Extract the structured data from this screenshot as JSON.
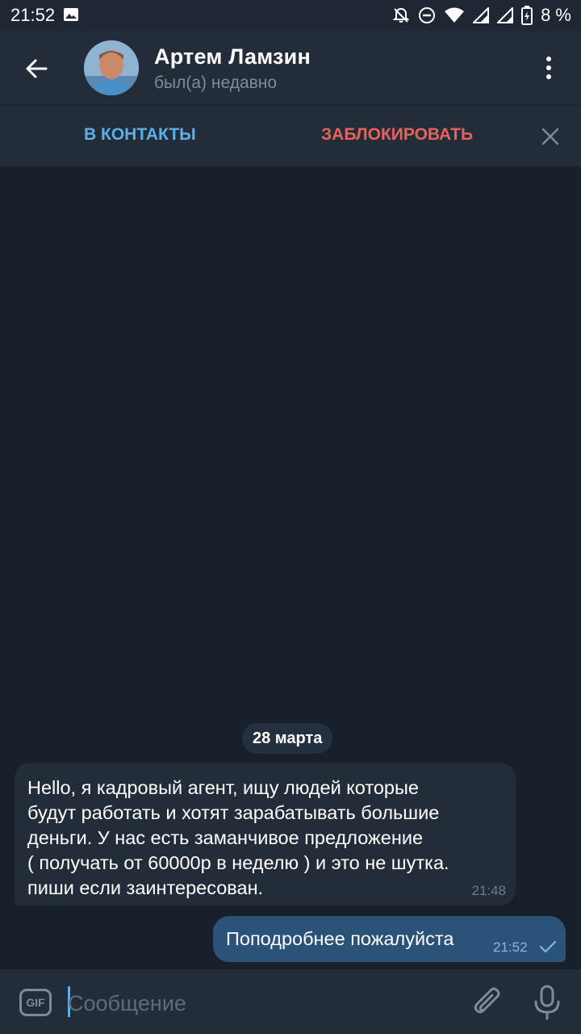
{
  "status_bar": {
    "time": "21:52",
    "battery": "8 %",
    "icons": [
      "image-icon",
      "bell-off-icon",
      "do-not-disturb-icon",
      "wifi-icon",
      "signal-icon",
      "signal-icon",
      "battery-icon"
    ]
  },
  "header": {
    "contact_name": "Артем Ламзин",
    "contact_status": "был(а) недавно",
    "back_icon": "arrow-left-icon",
    "menu_icon": "more-vertical-icon"
  },
  "action_bar": {
    "add_contact_label": "В КОНТАКТЫ",
    "block_label": "ЗАБЛОКИРОВАТЬ",
    "close_icon": "close-icon",
    "add_color": "#5eaee8",
    "block_color": "#e5635b"
  },
  "chat": {
    "date_separator": "28 марта",
    "messages": [
      {
        "direction": "incoming",
        "text": "Hello, я кадровый агент, ищу людей которые\nбудут работать и хотят зарабатывать большие\nденьги.  У нас есть заманчивое предложение\n( получать от 60000р в неделю ) и это не шутка.\nпиши если заинтересован.",
        "time": "21:48"
      },
      {
        "direction": "outgoing",
        "text": "Поподробнее пожалуйста",
        "time": "21:52",
        "status": "sent"
      }
    ]
  },
  "input_bar": {
    "gif_label": "GIF",
    "placeholder": "Сообщение",
    "value": "",
    "attach_icon": "paperclip-icon",
    "mic_icon": "microphone-icon"
  },
  "colors": {
    "background": "#18202b",
    "header": "#232d3a",
    "incoming_bubble": "#222d39",
    "outgoing_bubble": "#2b5278"
  }
}
